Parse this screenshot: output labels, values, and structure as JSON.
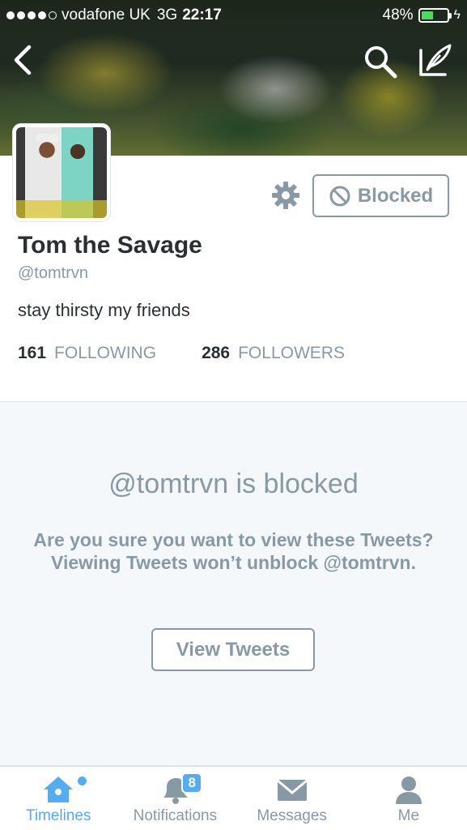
{
  "status_bar": {
    "carrier": "vodafone UK",
    "network": "3G",
    "time": "22:17",
    "battery": "48%",
    "battery_level": 0.48
  },
  "header": {
    "back_icon": "chevron-left-icon",
    "search_icon": "search-icon",
    "compose_icon": "compose-icon"
  },
  "profile": {
    "name": "Tom the Savage",
    "handle": "@tomtrvn",
    "bio": "stay thirsty my friends",
    "blocked_label": "Blocked",
    "following_count": "161",
    "following_label": "FOLLOWING",
    "followers_count": "286",
    "followers_label": "FOLLOWERS"
  },
  "blocked_panel": {
    "title": "@tomtrvn is blocked",
    "message": "Are you sure you want to view these Tweets? Viewing Tweets won’t unblock @tomtrvn.",
    "button_label": "View Tweets"
  },
  "tabs": [
    {
      "label": "Timelines",
      "icon": "home-icon",
      "active": true
    },
    {
      "label": "Notifications",
      "icon": "bell-icon",
      "badge": "8"
    },
    {
      "label": "Messages",
      "icon": "envelope-icon"
    },
    {
      "label": "Me",
      "icon": "person-icon"
    }
  ],
  "colors": {
    "accent": "#55acee",
    "muted": "#8899a6",
    "text": "#292f33",
    "battery": "#4cd964"
  }
}
